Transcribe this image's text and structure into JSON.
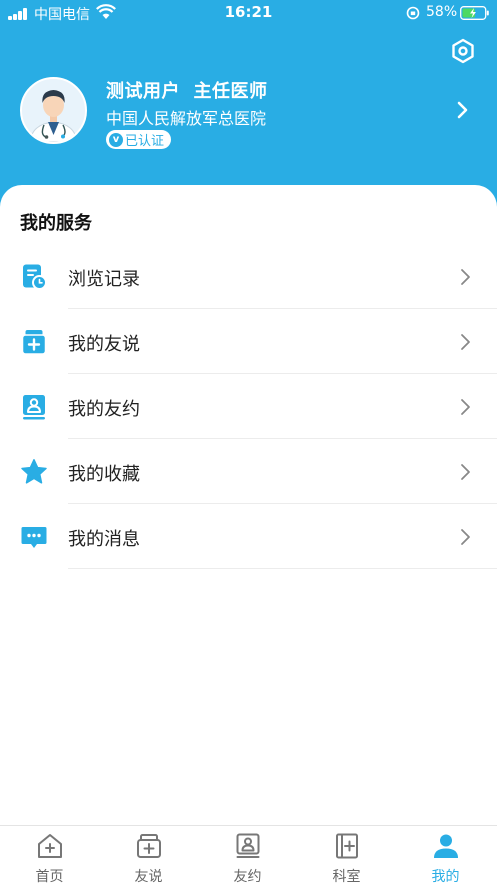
{
  "status_bar": {
    "carrier": "中国电信",
    "time": "16:21",
    "battery": "58%"
  },
  "profile": {
    "name_title": "测试用户  主任医师",
    "hospital": "中国人民解放军总医院",
    "verified_mark": "v",
    "verified_label": "已认证"
  },
  "services": {
    "title": "我的服务",
    "items": [
      {
        "label": "浏览记录",
        "icon": "history-icon"
      },
      {
        "label": "我的友说",
        "icon": "posts-icon"
      },
      {
        "label": "我的友约",
        "icon": "appointment-icon"
      },
      {
        "label": "我的收藏",
        "icon": "star-icon"
      },
      {
        "label": "我的消息",
        "icon": "message-icon"
      }
    ]
  },
  "tabs": [
    {
      "label": "首页",
      "icon": "home-icon"
    },
    {
      "label": "友说",
      "icon": "posts-icon"
    },
    {
      "label": "友约",
      "icon": "appointment-icon"
    },
    {
      "label": "科室",
      "icon": "department-icon"
    },
    {
      "label": "我的",
      "icon": "person-icon",
      "active": true
    }
  ],
  "colors": {
    "accent": "#29ADE4",
    "text": "#222222",
    "inactive_tab": "#666666"
  }
}
